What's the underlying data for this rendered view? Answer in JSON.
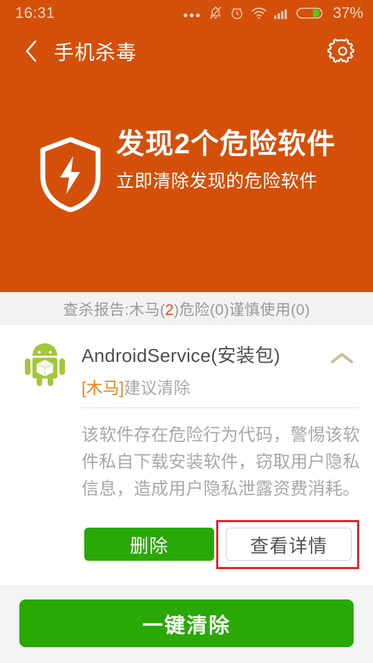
{
  "statusbar": {
    "time": "16:31",
    "battery_percent": "37%",
    "icons": [
      "more-dots-icon",
      "bell-muted-icon",
      "alarm-clock-icon",
      "wifi-icon",
      "signal-bars-icon",
      "battery-icon"
    ],
    "battery_level": 37
  },
  "navbar": {
    "back_icon": "chevron-left-icon",
    "title": "手机杀毒",
    "settings_icon": "gear-icon"
  },
  "hero": {
    "shield_icon": "shield-bolt-icon",
    "title": "发现2个危险软件",
    "subtitle": "立即清除发现的危险软件",
    "bg_color": "#d4500a"
  },
  "report": {
    "prefix": "查杀报告:木马(",
    "highlight": "2",
    "suffix": ")危险(0)谨慎使用(0)",
    "highlight_color": "#e8482a"
  },
  "threat": {
    "icon": "android-package-icon",
    "name": "AndroidService(安装包)",
    "tag": "[木马]",
    "advice": "建议清除",
    "collapse_icon": "chevron-up-icon",
    "description": "该软件存在危险行为代码，警惕该软件私自下载安装软件，窃取用户隐私信息，造成用户隐私泄露资费消耗。",
    "delete_label": "删除",
    "detail_label": "查看详情",
    "highlight_box_color": "#e8202a"
  },
  "bottom": {
    "clear_label": "一键清除",
    "button_color": "#2aa808"
  }
}
